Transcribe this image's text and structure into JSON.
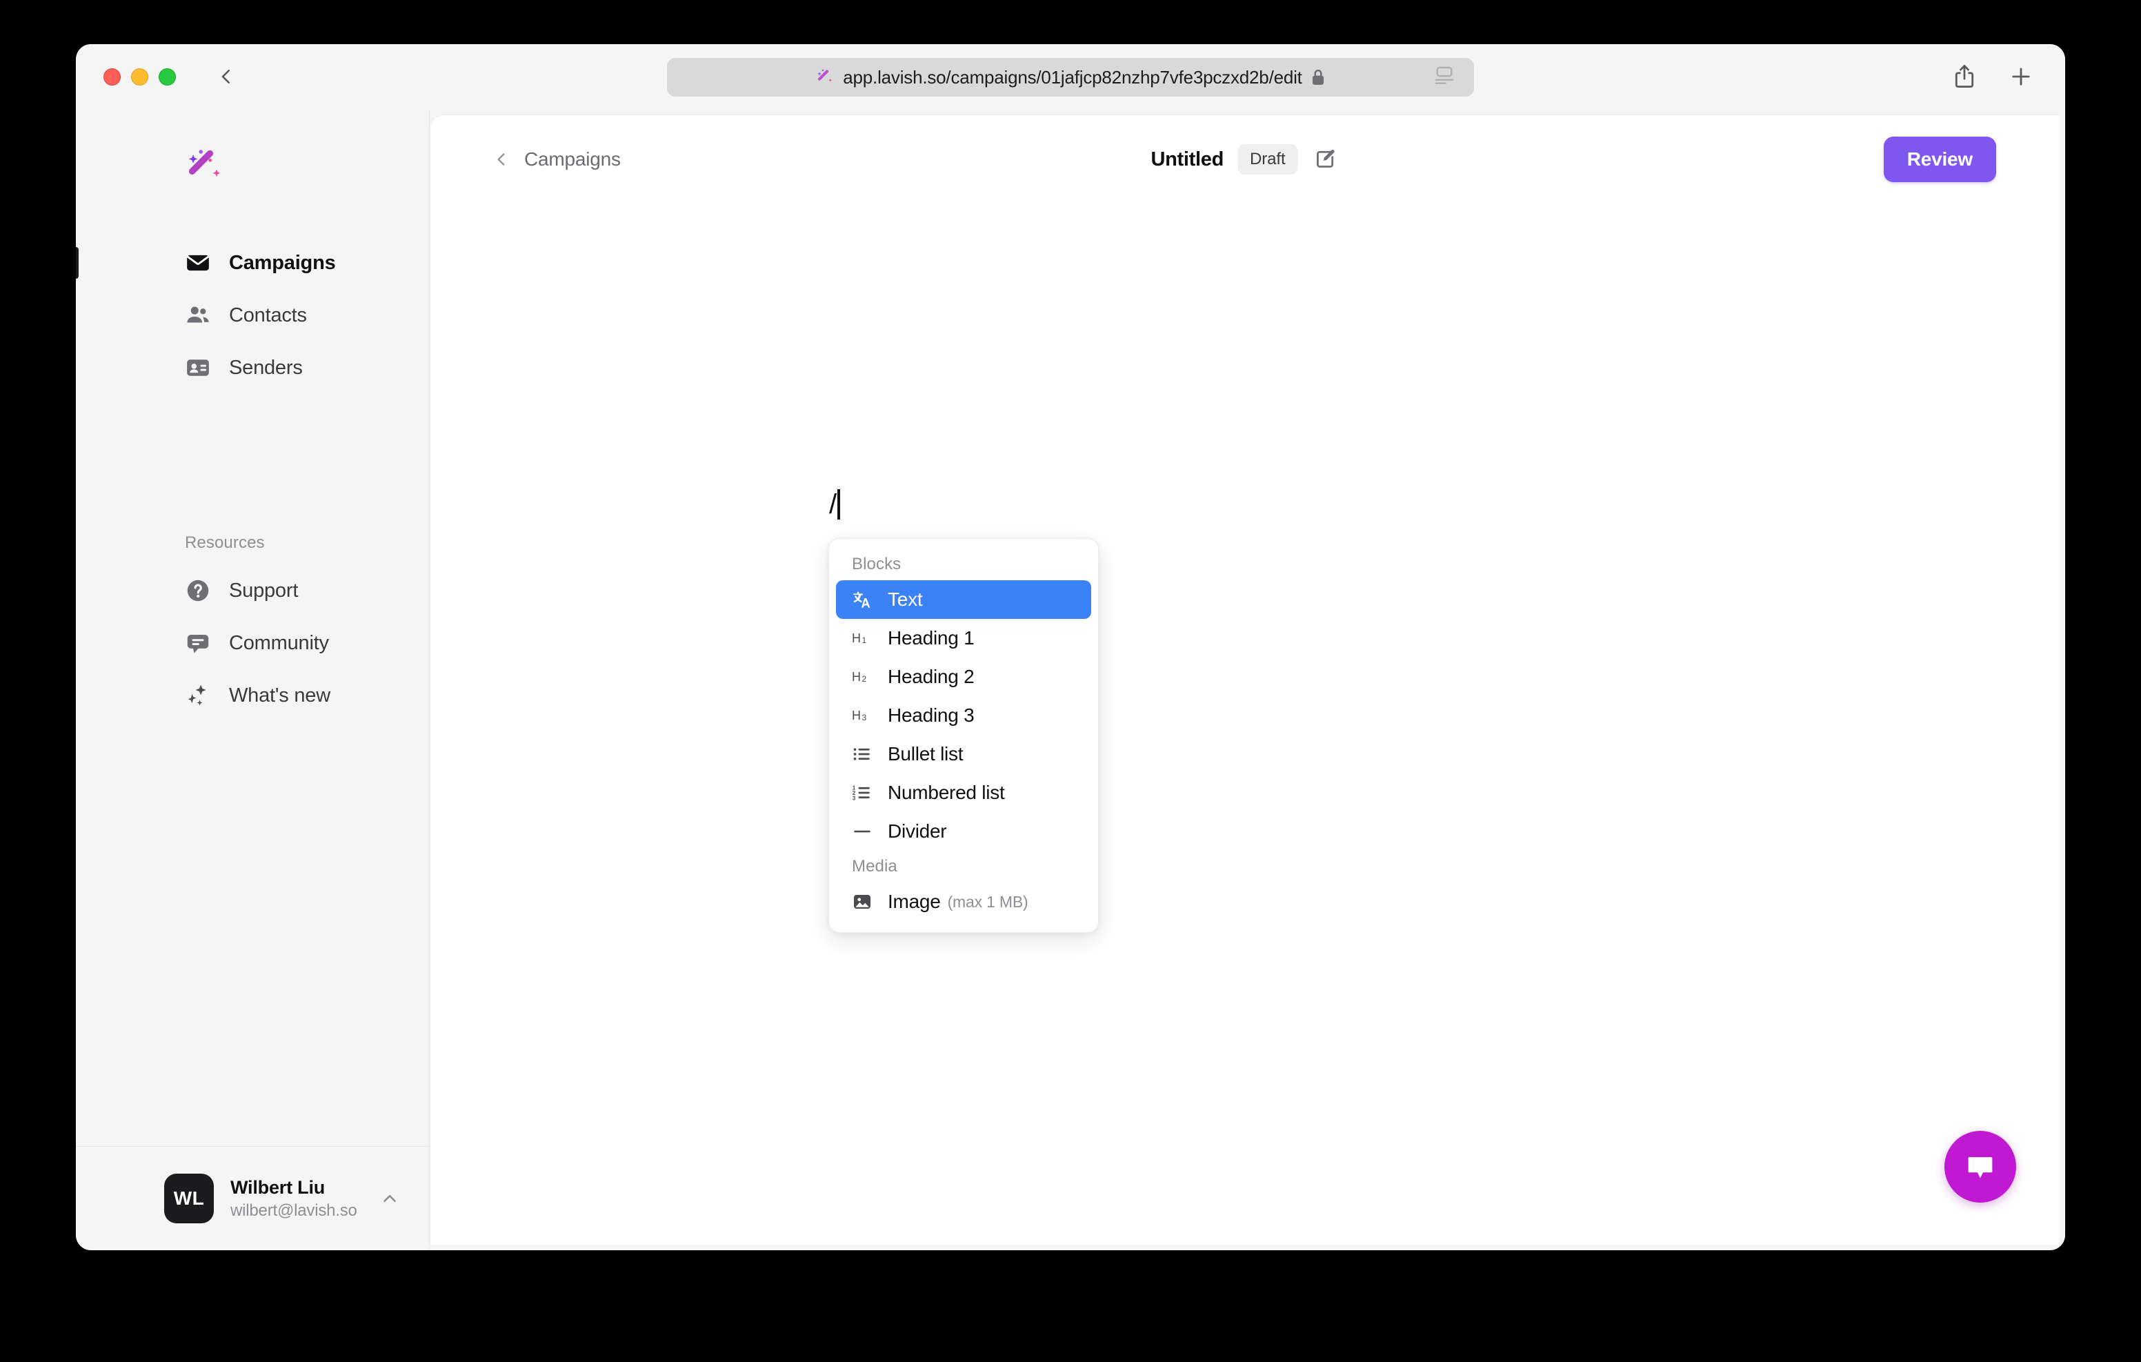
{
  "browser": {
    "url": "app.lavish.so/campaigns/01jafjcp82nzhp7vfe3pczxd2b/edit",
    "back_label": "Back",
    "share_label": "Share",
    "new_tab_label": "New Tab",
    "reader_label": "Reader View",
    "lock_label": "Secure"
  },
  "sidebar": {
    "brand": "Lavish",
    "primary": [
      {
        "id": "campaigns",
        "label": "Campaigns",
        "icon": "envelope-icon",
        "active": true
      },
      {
        "id": "contacts",
        "label": "Contacts",
        "icon": "people-icon",
        "active": false
      },
      {
        "id": "senders",
        "label": "Senders",
        "icon": "contact-card-icon",
        "active": false
      }
    ],
    "section_label": "Resources",
    "resources": [
      {
        "id": "support",
        "label": "Support",
        "icon": "question-circle-icon"
      },
      {
        "id": "community",
        "label": "Community",
        "icon": "chat-bubble-icon"
      },
      {
        "id": "whats-new",
        "label": "What's new",
        "icon": "sparkles-icon"
      }
    ],
    "user": {
      "initials": "WL",
      "name": "Wilbert Liu",
      "email": "wilbert@lavish.so",
      "chevron": "chevron-up-icon"
    }
  },
  "header": {
    "breadcrumb_label": "Campaigns",
    "doc_title": "Untitled",
    "status_badge": "Draft",
    "edit_title_icon": "pencil-square-icon",
    "review_label": "Review"
  },
  "editor": {
    "typed_text": "/"
  },
  "slash_menu": {
    "groups": [
      {
        "label": "Blocks",
        "items": [
          {
            "id": "text",
            "label": "Text",
            "icon": "translate-icon",
            "hint": "",
            "selected": true
          },
          {
            "id": "heading-1",
            "label": "Heading 1",
            "icon": "h1-icon",
            "hint": "",
            "selected": false
          },
          {
            "id": "heading-2",
            "label": "Heading 2",
            "icon": "h2-icon",
            "hint": "",
            "selected": false
          },
          {
            "id": "heading-3",
            "label": "Heading 3",
            "icon": "h3-icon",
            "hint": "",
            "selected": false
          },
          {
            "id": "bullet-list",
            "label": "Bullet list",
            "icon": "bullet-list-icon",
            "hint": "",
            "selected": false
          },
          {
            "id": "numbered-list",
            "label": "Numbered list",
            "icon": "numbered-list-icon",
            "hint": "",
            "selected": false
          },
          {
            "id": "divider",
            "label": "Divider",
            "icon": "divider-icon",
            "hint": "",
            "selected": false
          }
        ]
      },
      {
        "label": "Media",
        "items": [
          {
            "id": "image",
            "label": "Image",
            "icon": "image-icon",
            "hint": "(max 1 MB)",
            "selected": false
          }
        ]
      }
    ]
  },
  "chat_widget": {
    "label": "Open chat",
    "icon": "chat-bubble-icon"
  },
  "colors": {
    "accent_purple": "#7f56f0",
    "selection_blue": "#3b82f6",
    "chat_magenta": "#c019d2",
    "sidebar_bg": "#f5f5f5",
    "panel_bg": "#ffffff",
    "window_bg": "#000000"
  }
}
